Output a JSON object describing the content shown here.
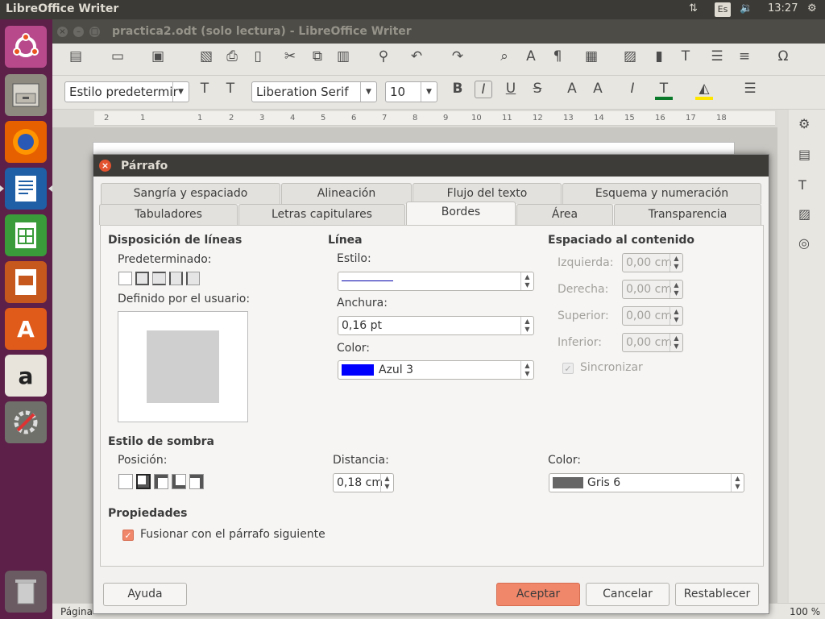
{
  "topbar": {
    "app_title": "LibreOffice Writer",
    "keyboard": "Es",
    "time": "13:27"
  },
  "window": {
    "title": "practica2.odt (solo lectura) - LibreOffice Writer"
  },
  "formatting": {
    "style": "Estilo predetermir",
    "font": "Liberation Serif",
    "size": "10"
  },
  "ruler": {
    "ticks": [
      "2",
      "1",
      "1",
      "2",
      "3",
      "4",
      "5",
      "6",
      "7",
      "8",
      "9",
      "10",
      "11",
      "12",
      "13",
      "14",
      "15",
      "16",
      "17",
      "18"
    ]
  },
  "statusbar": {
    "page": "Página",
    "zoom": "100 %"
  },
  "dialog": {
    "title": "Párrafo",
    "tabs_row1": [
      "Sangría y espaciado",
      "Alineación",
      "Flujo del texto",
      "Esquema y numeración"
    ],
    "tabs_row2": [
      "Tabuladores",
      "Letras capitulares",
      "Bordes",
      "Área",
      "Transparencia"
    ],
    "active_tab": "Bordes",
    "line_arrangement": {
      "heading": "Disposición de líneas",
      "default_label": "Predeterminado:",
      "user_label": "Definido por el usuario:"
    },
    "line": {
      "heading": "Línea",
      "style_label": "Estilo:",
      "width_label": "Anchura:",
      "width_value": "0,16 pt",
      "color_label": "Color:",
      "color_value": "Azul 3",
      "color_hex": "#0000ff"
    },
    "padding": {
      "heading": "Espaciado al contenido",
      "left_label": "Izquierda:",
      "right_label": "Derecha:",
      "top_label": "Superior:",
      "bottom_label": "Inferior:",
      "left_value": "0,00 cm",
      "right_value": "0,00 cm",
      "top_value": "0,00 cm",
      "bottom_value": "0,00 cm",
      "sync_label": "Sincronizar"
    },
    "shadow": {
      "heading": "Estilo de sombra",
      "position_label": "Posición:",
      "distance_label": "Distancia:",
      "distance_value": "0,18 cm",
      "color_label": "Color:",
      "color_value": "Gris 6",
      "color_hex": "#666666"
    },
    "properties": {
      "heading": "Propiedades",
      "merge_label": "Fusionar con el párrafo siguiente"
    },
    "buttons": {
      "help": "Ayuda",
      "ok": "Aceptar",
      "cancel": "Cancelar",
      "reset": "Restablecer"
    }
  }
}
